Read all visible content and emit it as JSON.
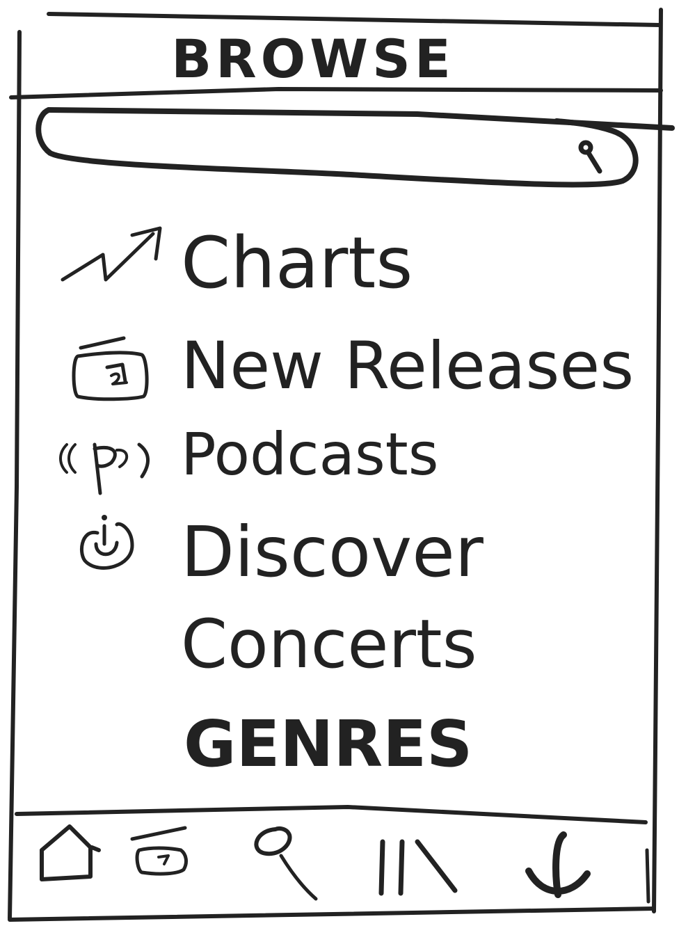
{
  "header": {
    "title": "BROWSE"
  },
  "search": {
    "value": "",
    "placeholder": ""
  },
  "menu": {
    "items": [
      {
        "label": "Charts",
        "icon": "trending-up-icon"
      },
      {
        "label": "New Releases",
        "icon": "album-icon"
      },
      {
        "label": "Podcasts",
        "icon": "podcast-icon"
      },
      {
        "label": "Discover",
        "icon": "discover-icon"
      },
      {
        "label": "Concerts",
        "icon": ""
      },
      {
        "label": "GENRES",
        "icon": ""
      }
    ]
  },
  "bottom_nav": {
    "items": [
      {
        "icon": "home-icon"
      },
      {
        "icon": "album-icon"
      },
      {
        "icon": "search-icon"
      },
      {
        "icon": "library-icon"
      },
      {
        "icon": "download-icon"
      }
    ]
  },
  "colors": {
    "ink": "#222222",
    "background": "#ffffff"
  }
}
